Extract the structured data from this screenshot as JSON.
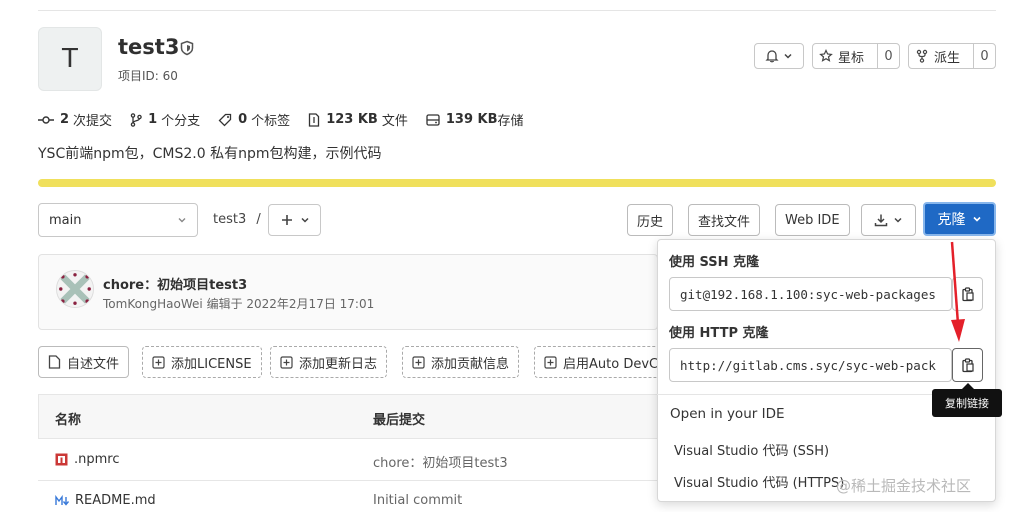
{
  "project": {
    "avatar_letter": "T",
    "name": "test3",
    "id_label": "项目ID: 60",
    "description": "YSC前端npm包，CMS2.0 私有npm包构建，示例代码"
  },
  "header_actions": {
    "star_label": "星标",
    "star_count": "0",
    "fork_label": "派生",
    "fork_count": "0"
  },
  "stats": {
    "commits_count": "2",
    "commits_label": "次提交",
    "branches_count": "1",
    "branches_label": "个分支",
    "tags_count": "0",
    "tags_label": "个标签",
    "files_size": "123 KB",
    "files_label": "文件",
    "storage_size": "139 KB",
    "storage_label": "存储"
  },
  "repo_bar": {
    "branch": "main",
    "breadcrumb": "test3",
    "separator": "/",
    "history_label": "历史",
    "find_file_label": "查找文件",
    "web_ide_label": "Web IDE",
    "clone_label": "克隆"
  },
  "last_commit": {
    "title": "chore：初始项目test3",
    "meta": "TomKongHaoWei 编辑于 2022年2月17日 17:01"
  },
  "quick_actions": {
    "readme": "自述文件",
    "license": "添加LICENSE",
    "changelog": "添加更新日志",
    "contributing": "添加贡献信息",
    "autodevops": "启用Auto DevC"
  },
  "table": {
    "col_name": "名称",
    "col_last_commit": "最后提交",
    "rows": [
      {
        "name": ".npmrc",
        "commit": "chore：初始项目test3"
      },
      {
        "name": "README.md",
        "commit": "Initial commit"
      }
    ]
  },
  "clone_dropdown": {
    "ssh_label": "使用 SSH 克隆",
    "ssh_url": "git@192.168.1.100:syc-web-packages",
    "http_label": "使用 HTTP 克隆",
    "http_url": "http://gitlab.cms.syc/syc-web-pack",
    "ide_heading": "Open in your IDE",
    "ide_ssh": "Visual Studio 代码 (SSH)",
    "ide_https": "Visual Studio 代码 (HTTPS)",
    "copy_tooltip": "复制链接"
  },
  "watermark": "@稀土掘金技术社区",
  "colors": {
    "accent_blue": "#1f69c5",
    "banner_yellow": "#f0e05c",
    "annotation_red": "#e4202a"
  }
}
